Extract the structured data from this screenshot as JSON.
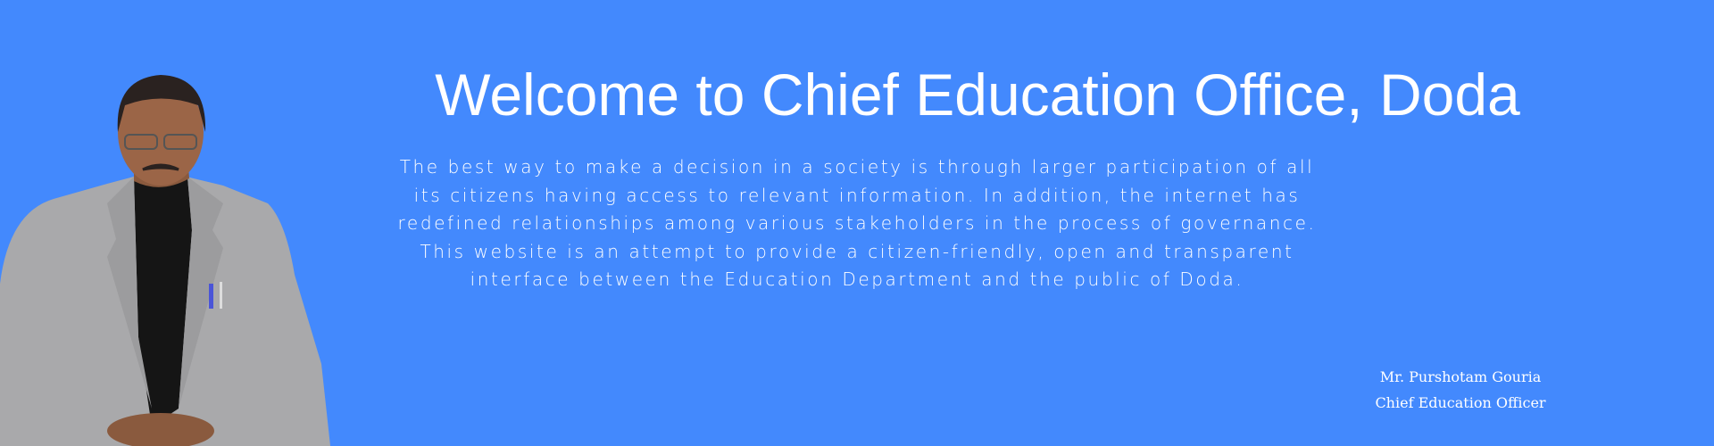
{
  "banner": {
    "background_color": "#4389fd",
    "title": "Welcome to Chief Education Office, Doda",
    "intro_lines": [
      "The best way to make a decision in a society is through larger participation of all",
      "its citizens having access to relevant information. In addition, the internet has",
      "redefined relationships among various stakeholders in the process of governance.",
      "This website is an attempt to provide a citizen-friendly, open and transparent",
      "interface between the Education Department and the public of Doda."
    ],
    "officer_name": "Mr. Purshotam Gouria",
    "officer_designation": "Chief Education Officer",
    "portrait": "photo of officer in grey blazer"
  }
}
